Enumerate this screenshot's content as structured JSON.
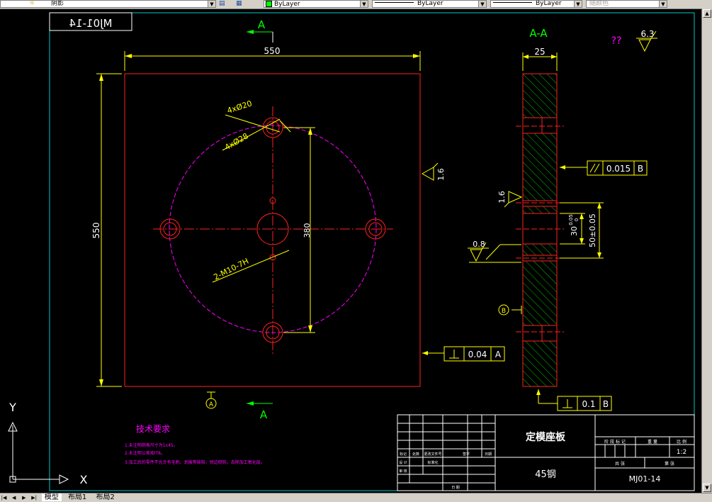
{
  "toolbar": {
    "layer_name": "阴影",
    "color": "ByLayer",
    "color_swatch": "#00ff00",
    "linetype": "ByLayer",
    "lineweight": "ByLayer",
    "plot_style": "随颜色"
  },
  "tabs": {
    "model": "模型",
    "layout1": "布局1",
    "layout2": "布局2"
  },
  "ucs": {
    "x_label": "X",
    "y_label": "Y"
  },
  "drawing": {
    "drawing_no_box": "MJ01-14",
    "section_mark_letter": "A",
    "section_title": "A-A",
    "unknown_symbol": "??",
    "roughness_global": "6.3",
    "dim_width": "550",
    "dim_height": "550",
    "dim_bolt_circle": "380",
    "dim_thickness": "25",
    "roughness_right": "1.6",
    "roughness_section": "1.6",
    "roughness_section2": "0.8",
    "label_4x20": "4xØ20",
    "label_4x28": "4xØ28",
    "label_m10": "2-M10-7H",
    "dim_30": "30",
    "dim_30_tol_upper": "0.05",
    "dim_30_tol_lower": "0",
    "dim_50": "50±0.05",
    "tol_parallel": "0.015",
    "tol_parallel_datum": "B",
    "tol_perp_a": "0.04",
    "tol_perp_a_datum": "A",
    "tol_perp_b": "0.1",
    "tol_perp_b_datum": "B",
    "datum_a": "A",
    "datum_b": "B",
    "tech_title": "技术要求",
    "tech_line1": "1.未注明倒角尺寸为1x45。",
    "tech_line2": "2.未注明公差按IT8。",
    "tech_line3": "3.加工后的零件不允许有毛刺、划痕等缺陷，锐边倒钝，去除加工氧化层。",
    "title_part_name": "定模座板",
    "title_material": "45钢",
    "title_drawing_no": "MJ01-14",
    "title_scale": "1:2",
    "tb_h_mark": "标记",
    "tb_h_qty": "处数",
    "tb_h_zone": "更改文件号",
    "tb_h_sign": "签字",
    "tb_h_date": "日期",
    "tb_design": "设 计",
    "tb_std": "标准化",
    "tb_review": "审 核",
    "tb_approve": "日 期",
    "tb_stage": "阶 段 标 记",
    "tb_weight": "重 量",
    "tb_scale_label": "比 例",
    "tb_total": "共     张",
    "tb_sheet": "第     张"
  }
}
